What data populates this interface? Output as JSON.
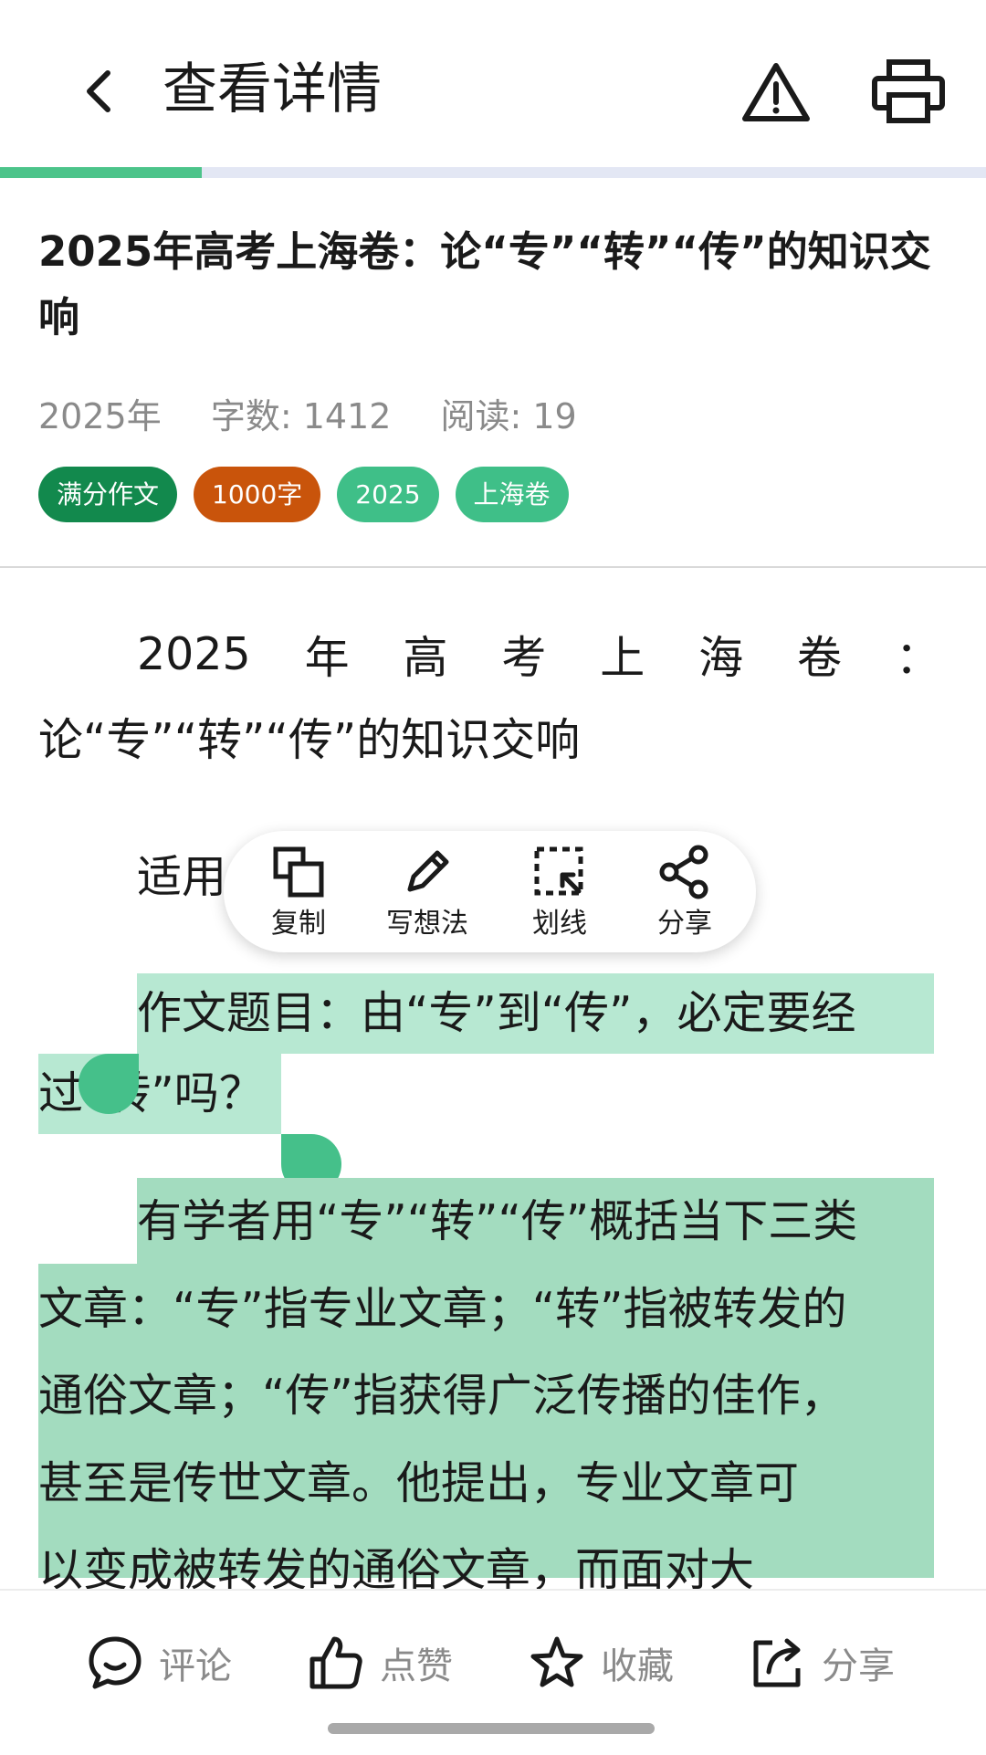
{
  "header": {
    "title": "查看详情",
    "icons": {
      "back": "chevron-left-icon",
      "report": "warning-triangle-icon",
      "print": "printer-icon"
    },
    "reading_progress": 0.205
  },
  "article": {
    "title": "2025年高考上海卷：论“专”“转”“传”的知识交响",
    "meta": {
      "year": "2025年",
      "word_count": "字数: 1412",
      "reads": "阅读: 19"
    },
    "tags": [
      "满分作文",
      "1000字",
      "2025",
      "上海卷"
    ],
    "tag_colors": [
      "#12894d",
      "#c9540b",
      "#3fbf88",
      "#3fbf88"
    ]
  },
  "body": {
    "heading_line1_chars": [
      "2025",
      "年",
      "高",
      "考",
      "上",
      "海",
      "卷",
      "："
    ],
    "heading_line2": "论“专”“转”“传”的知识交响",
    "partial_line": "适用",
    "prompt_line1": "作文题目：由“专”到“传”，必定要经",
    "prompt_line2": "过“转”吗？",
    "para_lines": [
      "有学者用“专”“转”“传”概括当下三类",
      "文章：“专”指专业文章；“转”指被转发的",
      "通俗文章；“传”指获得广泛传播的佳作，",
      "甚至是传世文章。他提出，专业文章可",
      "以变成被转发的通俗文章，而面对大"
    ]
  },
  "context_menu": {
    "items": [
      {
        "label": "复制",
        "icon": "copy-icon"
      },
      {
        "label": "写想法",
        "icon": "pencil-icon"
      },
      {
        "label": "划线",
        "icon": "underline-select-icon"
      },
      {
        "label": "分享",
        "icon": "share-icon"
      }
    ]
  },
  "bottom_bar": {
    "items": [
      {
        "label": "评论",
        "icon": "comment-icon"
      },
      {
        "label": "点赞",
        "icon": "thumbs-up-icon"
      },
      {
        "label": "收藏",
        "icon": "star-icon"
      },
      {
        "label": "分享",
        "icon": "share-out-icon"
      }
    ]
  },
  "colors": {
    "accent": "#4cc48a",
    "highlight": "#b7e8d2",
    "highlight_strong": "#a3dcbf",
    "track": "#e3e7f4"
  }
}
